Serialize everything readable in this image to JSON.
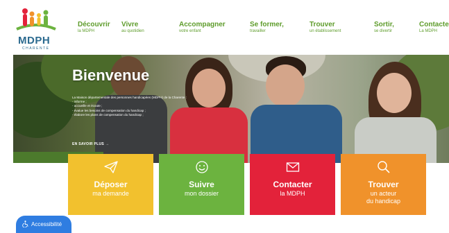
{
  "logo": {
    "text": "MDPH",
    "sub": "CHARENTE"
  },
  "nav": [
    {
      "title": "Découvrir",
      "sub": "la MDPH"
    },
    {
      "title": "Vivre",
      "sub": "au quotidien"
    },
    {
      "title": "Accompagner",
      "sub": "votre enfant"
    },
    {
      "title": "Se former,",
      "sub": "travailler"
    },
    {
      "title": "Trouver",
      "sub": "un établissement"
    },
    {
      "title": "Sortir,",
      "sub": "se divertir"
    },
    {
      "title": "Contacter",
      "sub": "La MDPH"
    }
  ],
  "hero": {
    "title": "Bienvenue",
    "lines": [
      "La Maison départementale des personnes handicapées (MDPH) de la Charente :",
      "- informe ;",
      "- accueille et écoute ;",
      "- évalue les besoins de compensation du handicap ;",
      "- élabore les plans de compensation du handicap ;"
    ],
    "more": "EN SAVOIR PLUS →"
  },
  "tiles": [
    {
      "line1": "Déposer",
      "line2": "ma demande",
      "icon": "paper-plane-icon",
      "color": "#f2c12e"
    },
    {
      "line1": "Suivre",
      "line2": "mon dossier",
      "icon": "smiley-icon",
      "color": "#6cb33f"
    },
    {
      "line1": "Contacter",
      "line2": "la MDPH",
      "icon": "envelope-icon",
      "color": "#e3223a"
    },
    {
      "line1": "Trouver",
      "line2": "un acteur",
      "line3": "du handicap",
      "icon": "search-icon",
      "color": "#f0922b"
    }
  ],
  "accessibility": {
    "label": "Accessibilité"
  }
}
